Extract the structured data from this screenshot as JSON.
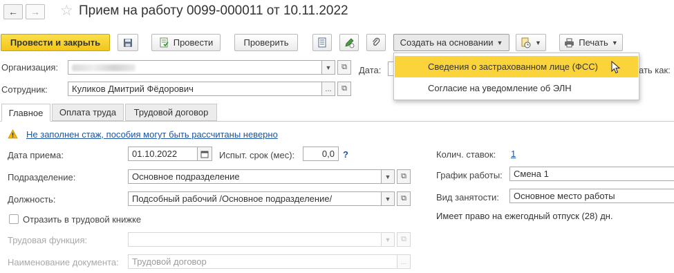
{
  "header": {
    "title": "Прием на работу 0099-000011 от 10.11.2022"
  },
  "toolbar": {
    "post_and_close": "Провести и закрыть",
    "post": "Провести",
    "check": "Проверить",
    "create_based_on": "Создать на основании",
    "print": "Печать"
  },
  "dropdown": {
    "items": [
      {
        "label": "Сведения о застрахованном лице (ФСС)",
        "highlighted": true
      },
      {
        "label": "Согласие на уведомление об ЭЛН",
        "highlighted": false
      }
    ],
    "highlight_color": "#fbd33b"
  },
  "header_fields": {
    "organization_label": "Организация:",
    "organization_value": "",
    "date_label": "Дата:",
    "partial_right_label": "ать как:",
    "employee_label": "Сотрудник:",
    "employee_value": "Куликов Дмитрий Фёдорович"
  },
  "tabs": [
    {
      "label": "Главное",
      "active": true
    },
    {
      "label": "Оплата труда",
      "active": false
    },
    {
      "label": "Трудовой договор",
      "active": false
    }
  ],
  "main": {
    "warning_text": "Не заполнен стаж, пособия могут быть рассчитаны неверно",
    "hire_date_label": "Дата приема:",
    "hire_date_value": "01.10.2022",
    "probation_label": "Испыт. срок (мес):",
    "probation_value": "0,0",
    "help_mark": "?",
    "department_label": "Подразделение:",
    "department_value": "Основное подразделение",
    "position_label": "Должность:",
    "position_value": "Подсобный рабочий /Основное подразделение/",
    "work_book_label": "Отразить в трудовой книжке",
    "work_book_checked": false,
    "labor_function_label": "Трудовая функция:",
    "labor_function_value": "",
    "doc_name_label": "Наименование документа:",
    "doc_name_value": "Трудовой договор"
  },
  "right_panel": {
    "rates_label": "Колич. ставок:",
    "rates_value": "1",
    "schedule_label": "График работы:",
    "schedule_value": "Смена 1",
    "employment_label": "Вид занятости:",
    "employment_value": "Основное место работы",
    "vacation_note": "Имеет право на ежегодный отпуск (28) дн."
  },
  "colors": {
    "primary_button": "#f2c51a",
    "link": "#1c55a3",
    "warning_icon": "#f2b800"
  }
}
